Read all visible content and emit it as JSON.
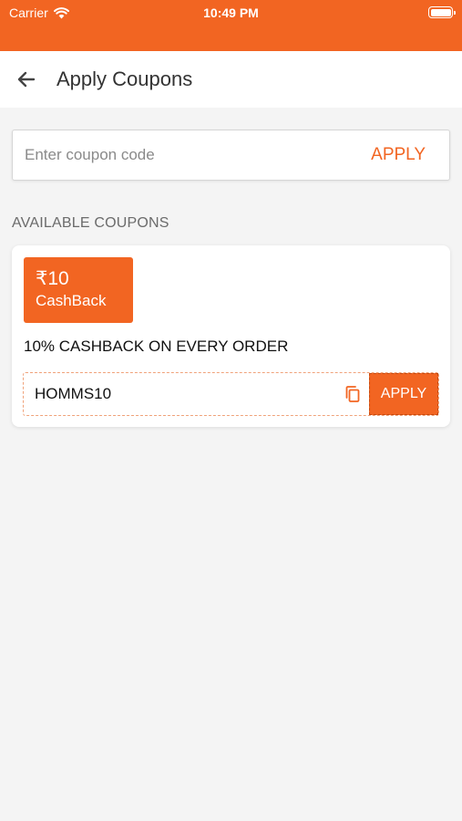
{
  "status_bar": {
    "carrier": "Carrier",
    "time": "10:49 PM"
  },
  "header": {
    "title": "Apply Coupons",
    "back_icon": "arrow-left-icon"
  },
  "coupon_entry": {
    "placeholder": "Enter coupon code",
    "value": "",
    "apply_label": "APPLY"
  },
  "available_coupons": {
    "heading": "AVAILABLE COUPONS",
    "items": [
      {
        "amount": "₹10",
        "type": "CashBack",
        "description": "10% CASHBACK ON EVERY ORDER",
        "code": "HOMMS10",
        "copy_icon": "copy-icon",
        "apply_label": "APPLY"
      }
    ]
  },
  "colors": {
    "accent": "#f26522",
    "background": "#f4f4f4",
    "card": "#ffffff",
    "text_primary": "#111111",
    "text_secondary": "#6b6b6b"
  }
}
